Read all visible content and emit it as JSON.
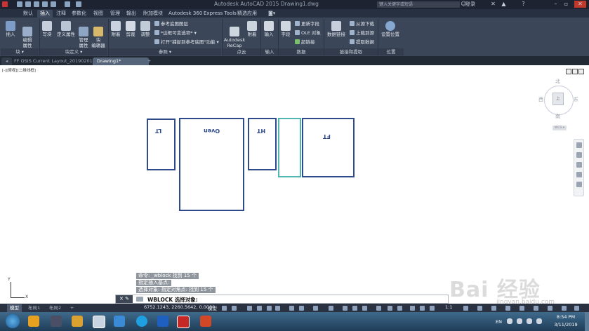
{
  "app": {
    "title": "Autodesk AutoCAD 2015    Drawing1.dwg",
    "search_placeholder": "键入关键字或短语",
    "login_label": "登录"
  },
  "ribbon_tabs": [
    "默认",
    "插入",
    "注释",
    "参数化",
    "视图",
    "管理",
    "输出",
    "附加模块",
    "Autodesk 360",
    "Express Tools",
    "精选应用"
  ],
  "active_ribbon_tab": "插入",
  "ribbon_groups": {
    "block": {
      "title": "块",
      "insert": "插入",
      "edit_attr": "编辑\n属性"
    },
    "block_def": {
      "title": "块定义",
      "create": "写块",
      "define_attr": "定义属性",
      "manage_attr": "管理\n属性",
      "block_editor": "块\n编辑器"
    },
    "reference": {
      "title": "参照",
      "attach": "附着",
      "clip": "剪裁",
      "adjust": "调整",
      "underlay_layers": "参考底图图层",
      "frames": "*边框可变选项*",
      "snap_underlay": "打开\"捕捉到参考底图\"功能"
    },
    "point_cloud": {
      "title": "点云",
      "recap": "Autodesk\nReCap",
      "attach": "附着"
    },
    "import": {
      "title": "输入",
      "import": "输入"
    },
    "data": {
      "title": "数据",
      "field": "字段",
      "update_fields": "更新字段",
      "ole": "OLE 对象",
      "hyperlink": "超链接"
    },
    "linking": {
      "title": "链接和提取",
      "data_link": "数据链接",
      "download": "从源下载",
      "upload": "上载到源",
      "extract": "提取数据"
    },
    "location": {
      "title": "位置",
      "set_location": "设置位置"
    }
  },
  "doc_tabs": [
    "FF OSIS Current Layout_20190201*",
    "Drawing1*"
  ],
  "active_doc_tab": "Drawing1*",
  "viewport_label": "[-][俯视][二维线框]",
  "drawing": {
    "rect_labels": [
      "LT",
      "Oven",
      "HT",
      "FT"
    ]
  },
  "viewcube": {
    "north": "北",
    "south": "南",
    "east": "东",
    "west": "西",
    "face": "上",
    "wcs": "WCS"
  },
  "command_history": [
    "命令: _wblock 找到 15 个",
    "指定插入基点:",
    "选择对象: 指定对角点: 找到 15 个"
  ],
  "command_line": {
    "prompt": "WBLOCK 选择对象:"
  },
  "ucs": {
    "x": "X",
    "y": "Y"
  },
  "layout_tabs": [
    "模型",
    "布局1",
    "布局2"
  ],
  "active_layout_tab": "模型",
  "status_bar": {
    "coordinates": "6752.1243, 2260.5642, 0.0000",
    "model_label": "模型",
    "scale": "1:1"
  },
  "taskbar": {
    "lang": "EN",
    "time": "8:54 PM",
    "date": "3/11/2019"
  },
  "watermark": {
    "logo": "Bai 经验",
    "url": "jingyan.baidu.com"
  },
  "colors": {
    "rect_stroke": "#2f4a8a",
    "rect_selected": "#4fb6b0",
    "ribbon_bg": "#3b4658",
    "titlebar_bg": "#1d2330"
  }
}
